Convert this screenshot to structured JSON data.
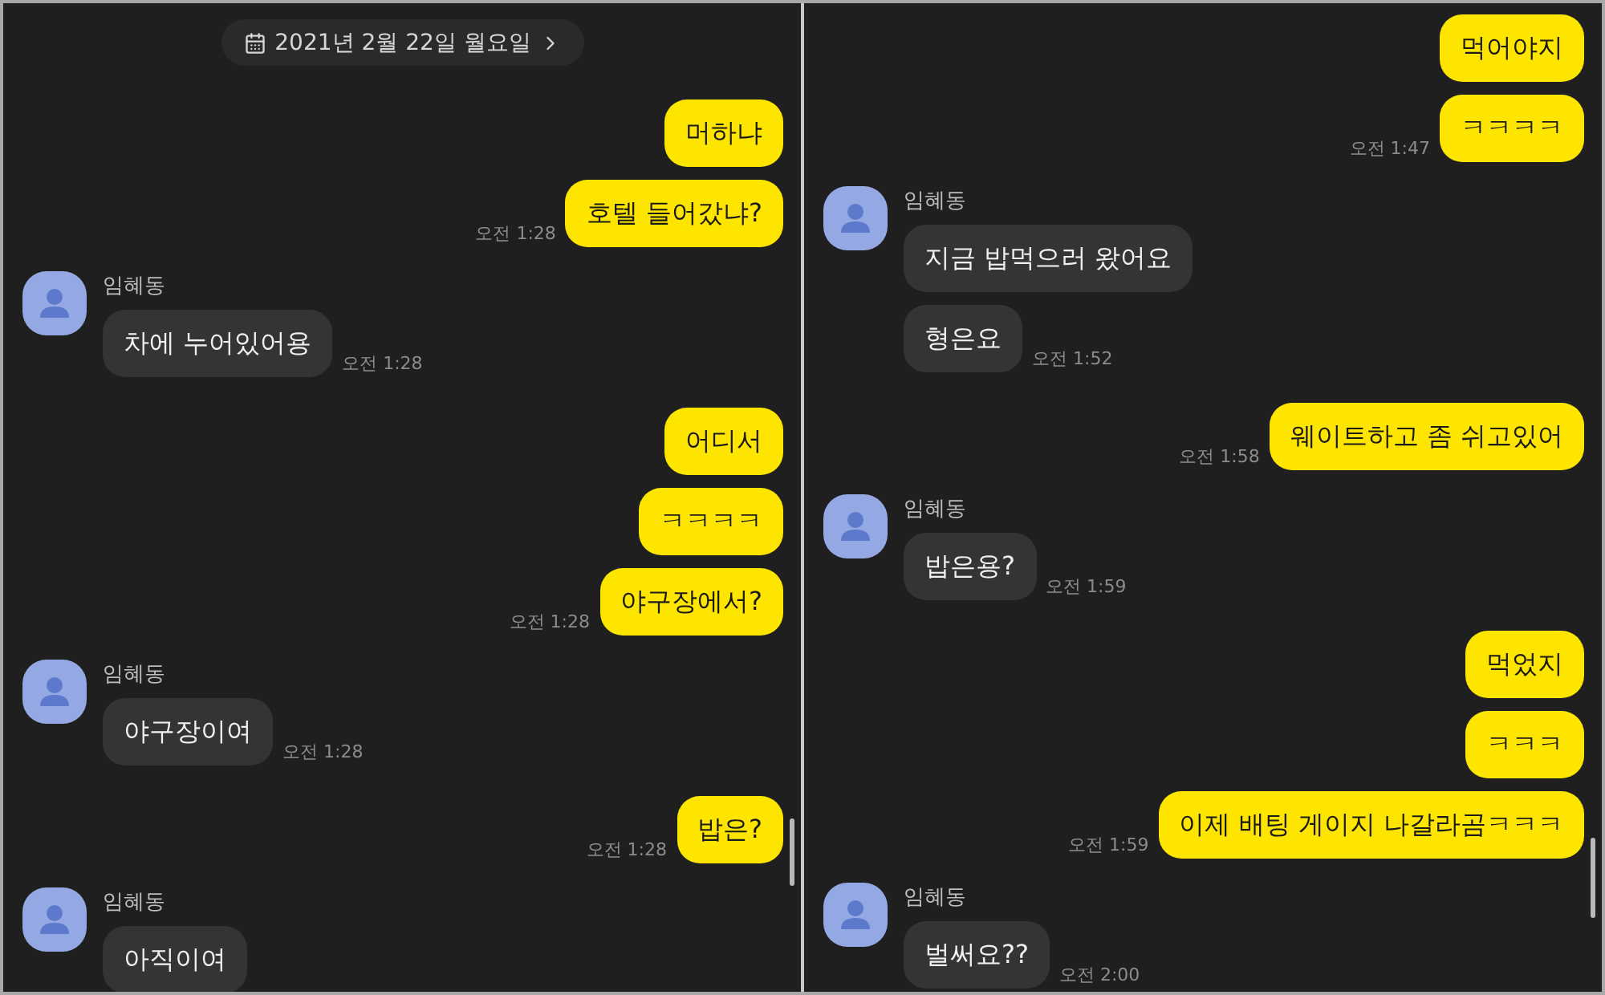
{
  "panels": [
    {
      "date_chip": "2021년 2월 22일 월요일",
      "groups": [
        {
          "kind": "sent",
          "messages": [
            "머하냐",
            "호텔 들어갔냐?"
          ],
          "time": "오전 1:28"
        },
        {
          "kind": "received",
          "sender": "임혜동",
          "messages": [
            "차에 누어있어용"
          ],
          "time": "오전 1:28"
        },
        {
          "kind": "sent",
          "messages": [
            "어디서",
            "ㅋㅋㅋㅋ",
            "야구장에서?"
          ],
          "time": "오전 1:28"
        },
        {
          "kind": "received",
          "sender": "임혜동",
          "messages": [
            "야구장이여"
          ],
          "time": "오전 1:28"
        },
        {
          "kind": "sent",
          "messages": [
            "밥은?"
          ],
          "time": "오전 1:28"
        },
        {
          "kind": "received",
          "sender": "임혜동",
          "messages": [
            "아직이여"
          ]
        }
      ]
    },
    {
      "groups": [
        {
          "kind": "sent",
          "messages": [
            "먹어야지",
            "ㅋㅋㅋㅋ"
          ],
          "time": "오전 1:47"
        },
        {
          "kind": "received",
          "sender": "임혜동",
          "messages": [
            "지금 밥먹으러 왔어요",
            "형은요"
          ],
          "time": "오전 1:52"
        },
        {
          "kind": "sent",
          "messages": [
            "웨이트하고 좀 쉬고있어"
          ],
          "time": "오전 1:58"
        },
        {
          "kind": "received",
          "sender": "임혜동",
          "messages": [
            "밥은용?"
          ],
          "time": "오전 1:59"
        },
        {
          "kind": "sent",
          "messages": [
            "먹었지",
            "ㅋㅋㅋ",
            "이제 배팅 게이지 나갈라곰ㅋㅋㅋ"
          ],
          "time": "오전 1:59"
        },
        {
          "kind": "received",
          "sender": "임혜동",
          "messages": [
            "벌써요??"
          ],
          "time": "오전 2:00"
        }
      ]
    }
  ]
}
